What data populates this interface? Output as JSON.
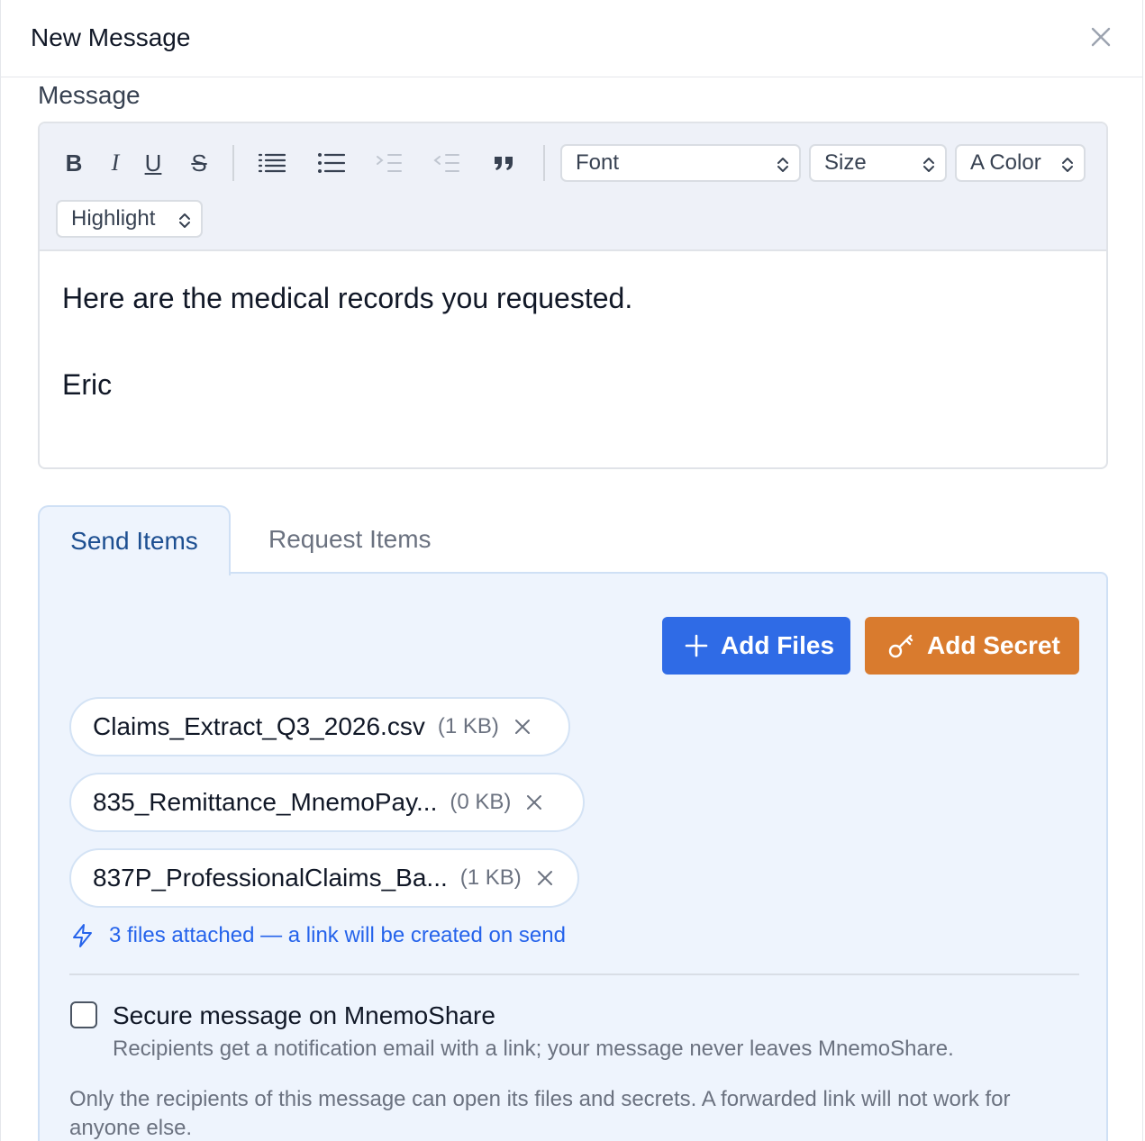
{
  "dialog": {
    "title": "New Message"
  },
  "message": {
    "label": "Message",
    "toolbar": {
      "bold": "B",
      "italic": "I",
      "underline": "U",
      "strike": "S",
      "font_select": "Font",
      "size_select": "Size",
      "color_select": "A Color",
      "highlight_select": "Highlight"
    },
    "body_lines": [
      "Here are the medical records you requested.",
      "",
      "Eric"
    ]
  },
  "tabs": [
    {
      "label": "Send Items",
      "active": true
    },
    {
      "label": "Request Items",
      "active": false
    }
  ],
  "actions": {
    "add_files": "Add Files",
    "add_secret": "Add Secret"
  },
  "files": [
    {
      "name": "Claims_Extract_Q3_2026.csv",
      "size": "(1 KB)"
    },
    {
      "name": "835_Remittance_MnemoPay...",
      "size": "(0 KB)"
    },
    {
      "name": "837P_ProfessionalClaims_Ba...",
      "size": "(1 KB)"
    }
  ],
  "notice": "3 files attached — a link will be created on send",
  "secure": {
    "checked": false,
    "label": "Secure message on MnemoShare",
    "description": "Recipients get a notification email with a link; your message never leaves MnemoShare."
  },
  "footnote": "Only the recipients of this message can open its files and secrets. A forwarded link will not work for anyone else.",
  "colors": {
    "primary": "#2f6be6",
    "secret": "#d97b2e",
    "tab_active_text": "#1d4f91",
    "link": "#2563eb",
    "panel_bg": "#eef4fd"
  }
}
